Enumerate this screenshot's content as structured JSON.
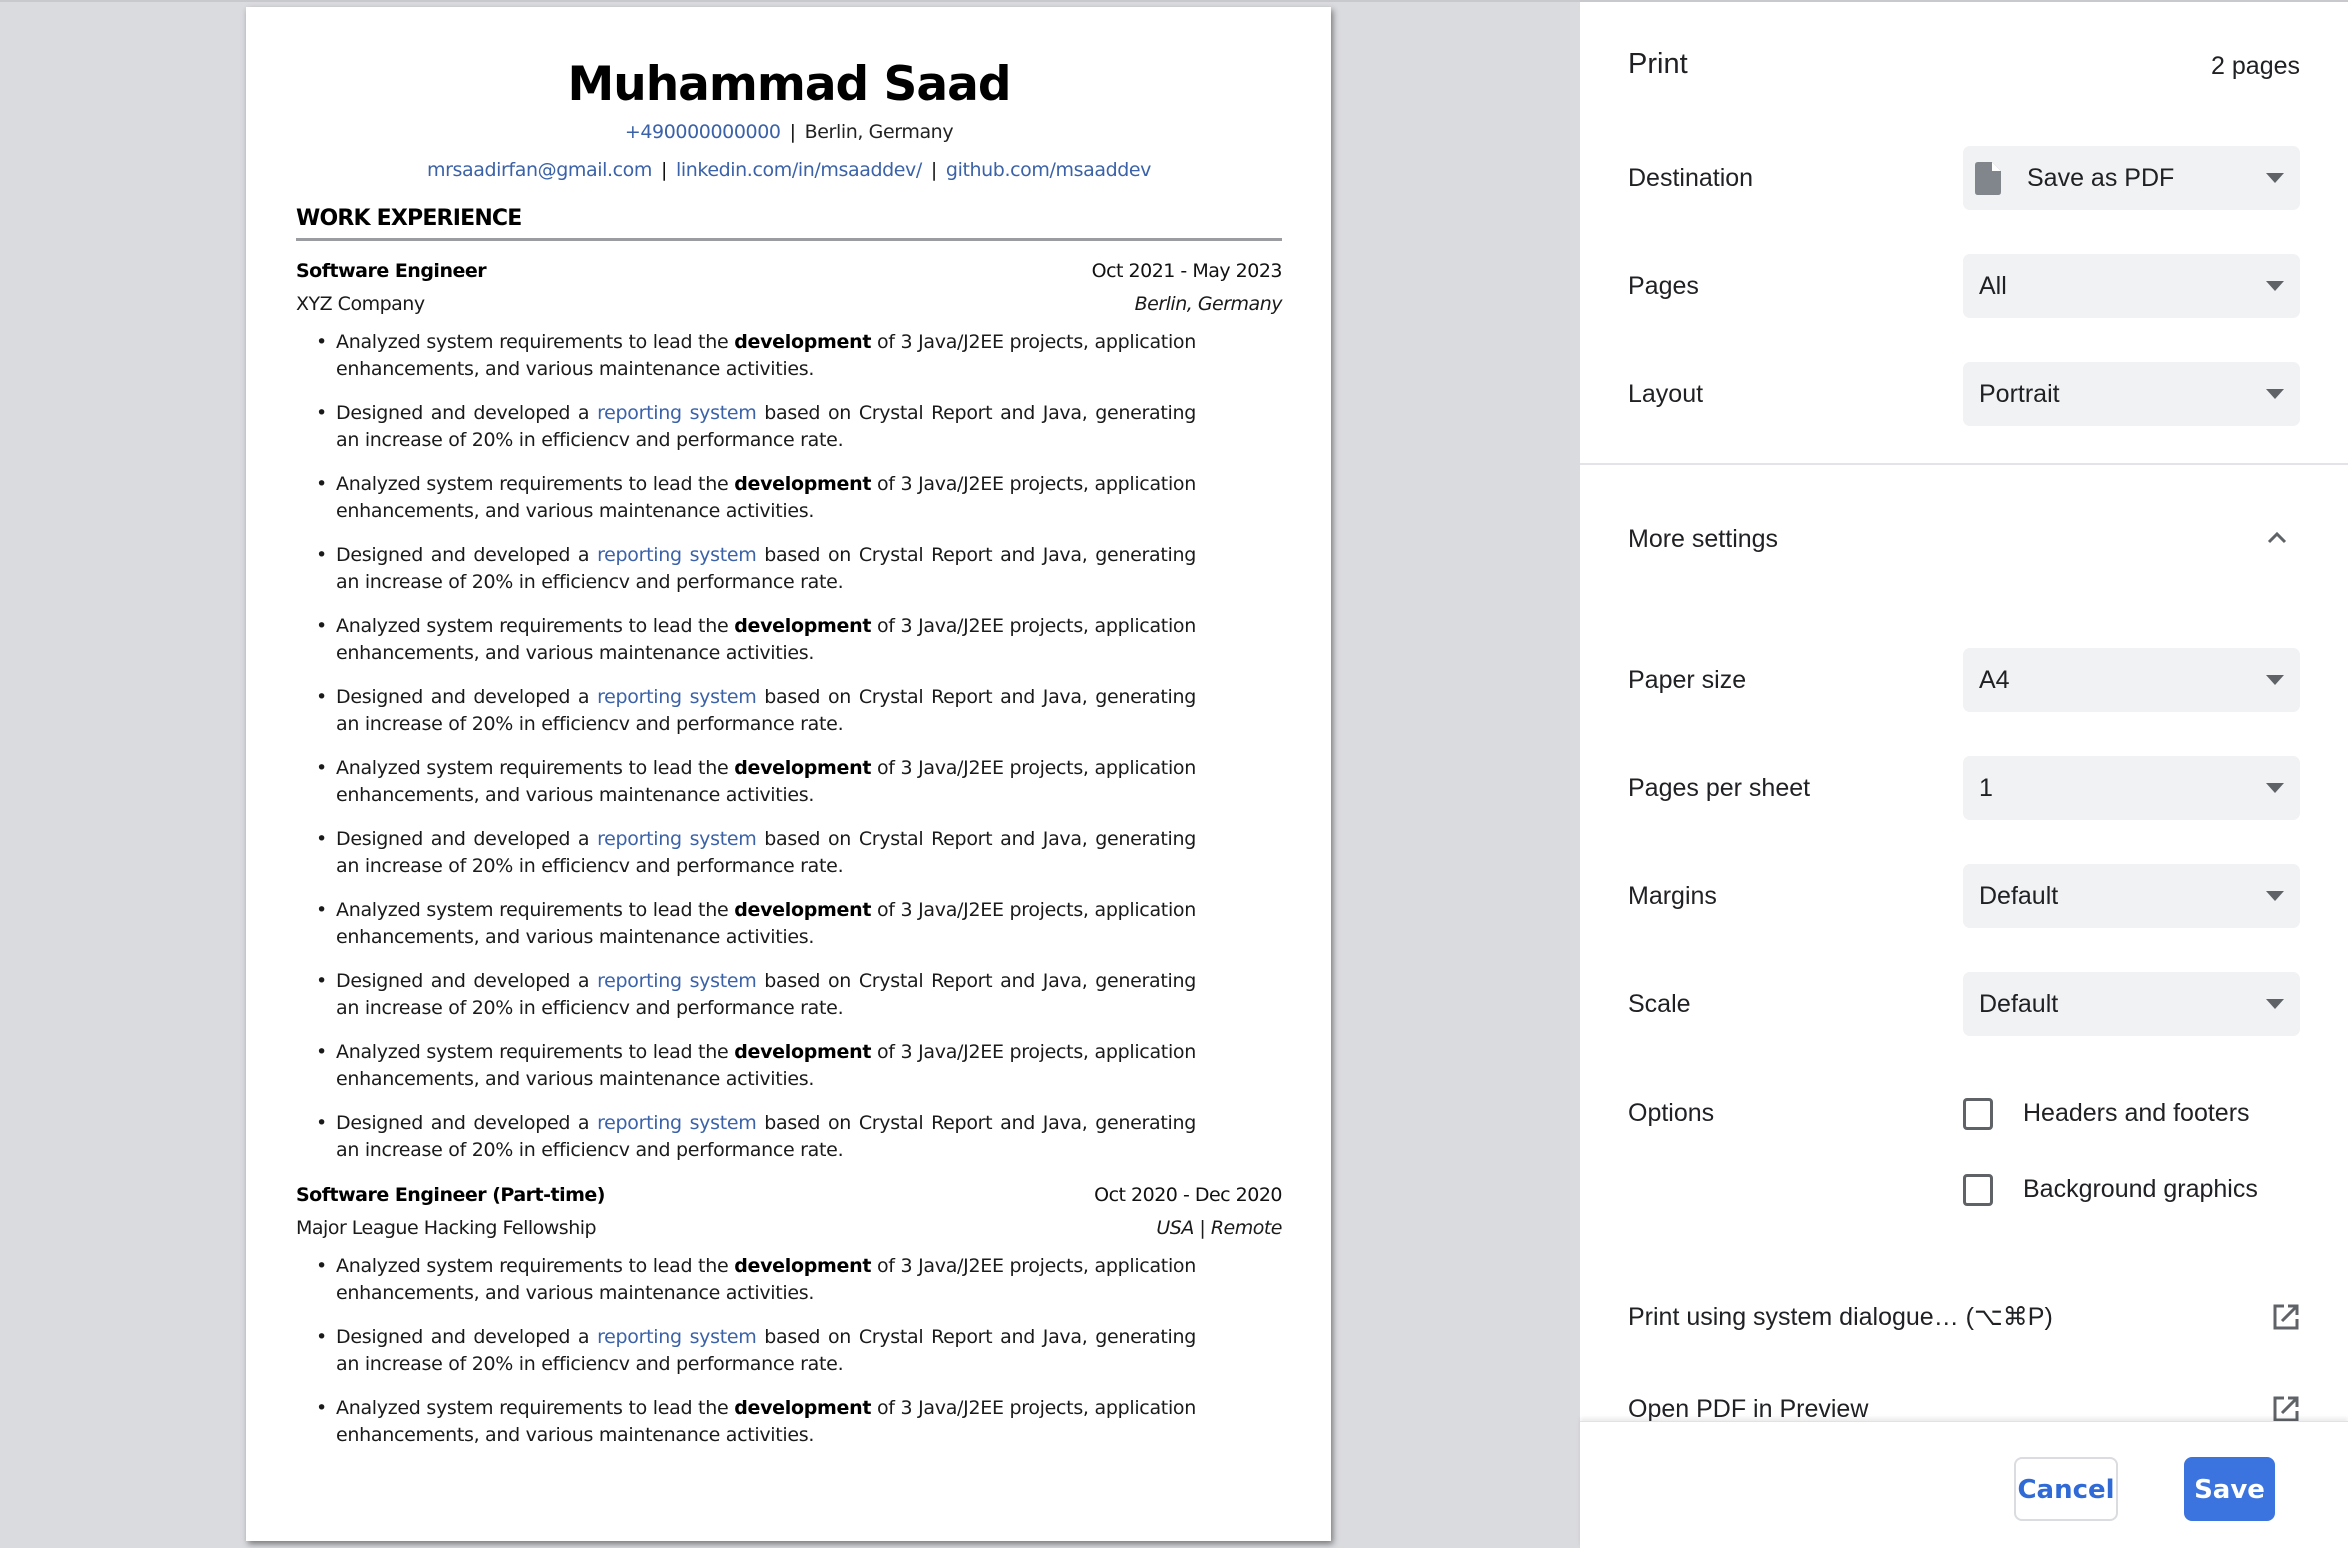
{
  "resume": {
    "name": "Muhammad Saad",
    "contact_line1": {
      "phone": "+490000000000",
      "location": "Berlin, Germany"
    },
    "contact_line2": {
      "email": "mrsaadirfan@gmail.com",
      "linkedin": "linkedin.com/in/msaaddev/",
      "github": "github.com/msaaddev"
    },
    "separator": "|",
    "section_title": "WORK EXPERIENCE",
    "bullet_char": "•",
    "bullet_a": {
      "pre": "Analyzed system requirements to lead the ",
      "bold": "development",
      "post": " of 3 Java/J2EE projects, application enhancements, and various maintenance activities."
    },
    "bullet_b": {
      "pre": "Designed and developed a ",
      "link": "reporting system",
      "post": " based on Crystal Report and Java, generating an increase of 20% in efficiencv and performance rate."
    },
    "jobs": [
      {
        "title": "Software Engineer",
        "dates": "Oct 2021 - May 2023",
        "company": "XYZ Company",
        "location": "Berlin, Germany",
        "bullet_pattern": [
          "a",
          "b",
          "a",
          "b",
          "a",
          "b",
          "a",
          "b",
          "a",
          "b",
          "a",
          "b"
        ]
      },
      {
        "title": "Software Engineer (Part-time)",
        "dates": "Oct 2020 - Dec 2020",
        "company": "Major League Hacking Fellowship",
        "location": "USA | Remote",
        "bullet_pattern": [
          "a",
          "b",
          "a"
        ]
      }
    ]
  },
  "print_panel": {
    "title": "Print",
    "page_count": "2 pages",
    "destination": {
      "label": "Destination",
      "value": "Save as PDF",
      "icon": "file-icon"
    },
    "pages": {
      "label": "Pages",
      "value": "All"
    },
    "layout": {
      "label": "Layout",
      "value": "Portrait"
    },
    "more_settings": {
      "label": "More settings",
      "expanded": true,
      "icon": "chevron-up-icon"
    },
    "paper_size": {
      "label": "Paper size",
      "value": "A4"
    },
    "pages_per_sheet": {
      "label": "Pages per sheet",
      "value": "1"
    },
    "margins": {
      "label": "Margins",
      "value": "Default"
    },
    "scale": {
      "label": "Scale",
      "value": "Default"
    },
    "options": {
      "label": "Options",
      "headers_footers": {
        "label": "Headers and footers",
        "checked": false
      },
      "background_graphics": {
        "label": "Background graphics",
        "checked": false
      }
    },
    "system_dialogue": {
      "label": "Print using system dialogue… (⌥⌘P)",
      "icon": "open-external-icon"
    },
    "open_preview": {
      "label": "Open PDF in Preview",
      "icon": "open-external-icon"
    },
    "cancel_label": "Cancel",
    "save_label": "Save",
    "colors": {
      "accent": "#3b74de",
      "link": "#3b62a8",
      "panel_bg": "#ffffff",
      "preview_bg": "#dadbdf",
      "select_bg": "#f1f2f4"
    }
  }
}
